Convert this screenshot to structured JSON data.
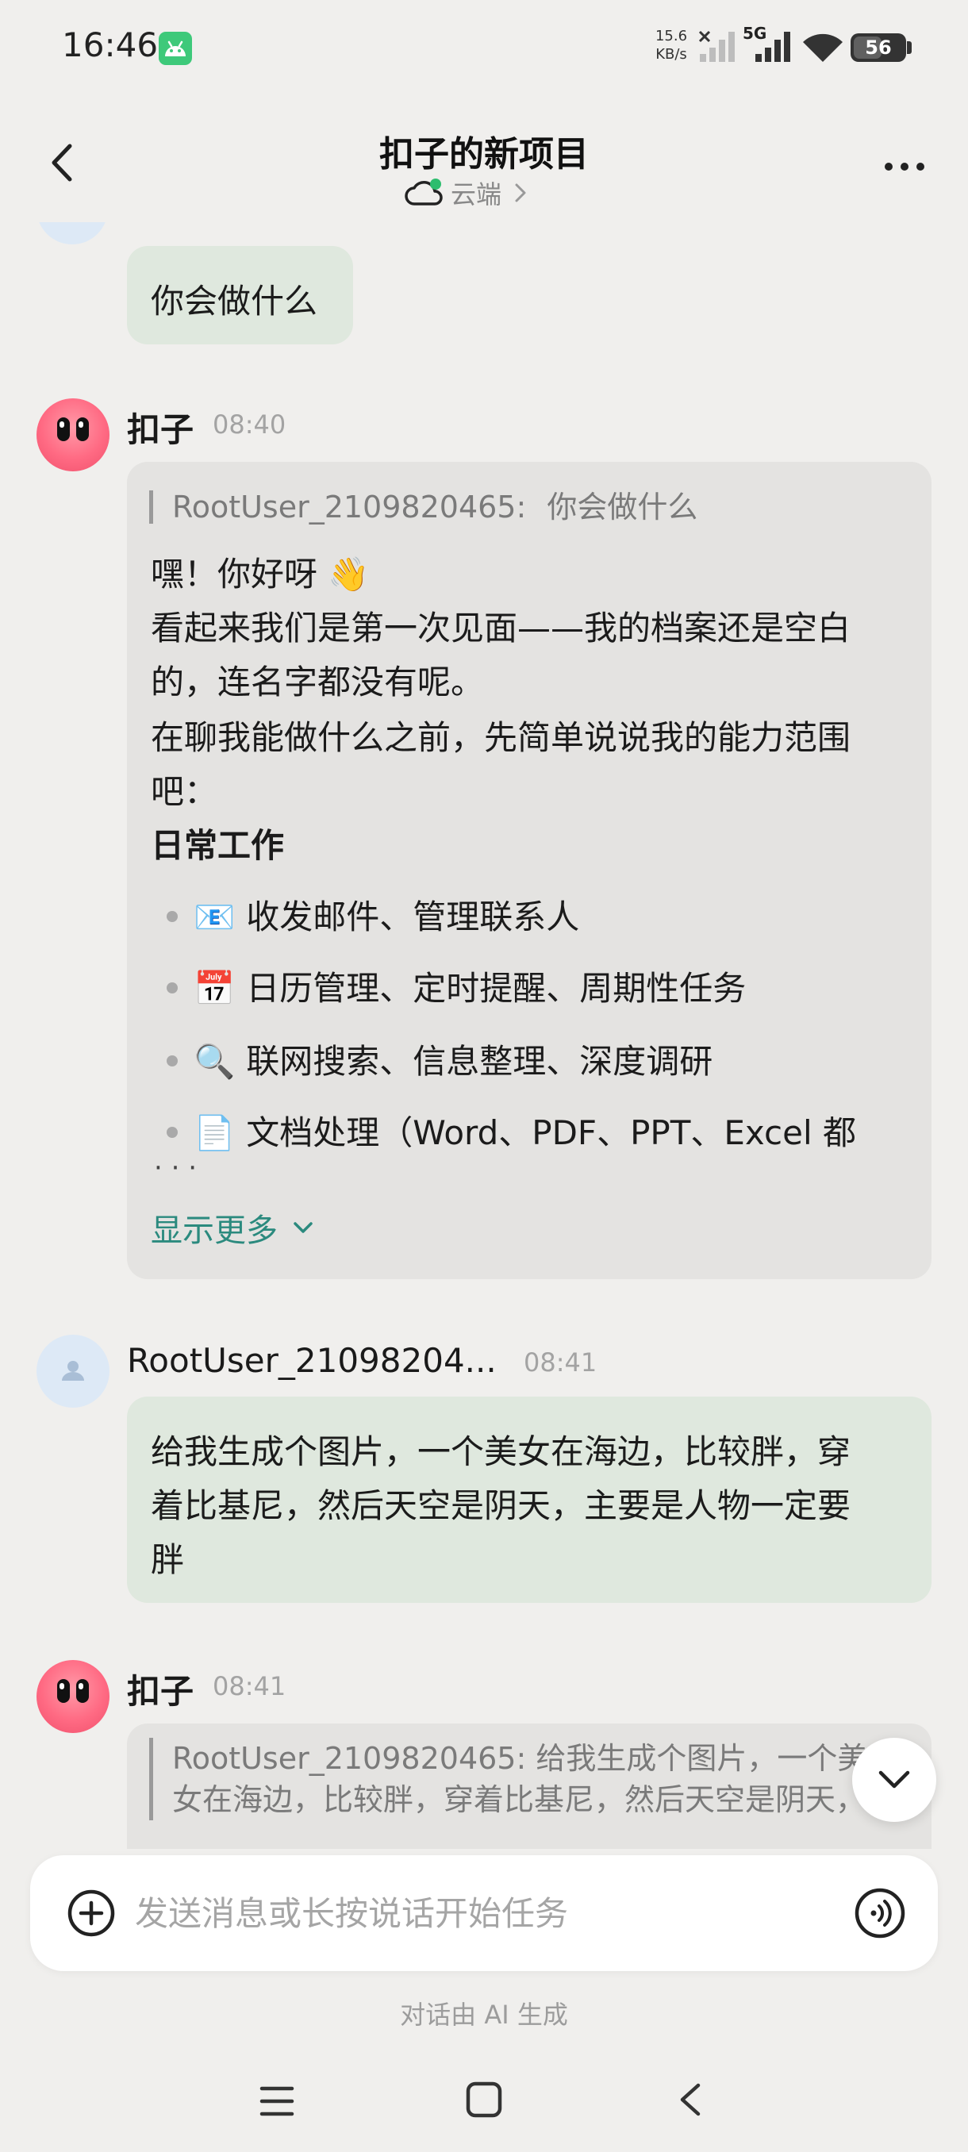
{
  "status_bar": {
    "time": "16:46",
    "net_speed_value": "15.6",
    "net_speed_unit": "KB/s",
    "network": "5G",
    "battery": "56",
    "battery_level": 0.56
  },
  "header": {
    "title": "扣子的新项目",
    "subtitle": "云端"
  },
  "messages": {
    "user_1": {
      "text": "你会做什么"
    },
    "bot_1": {
      "name": "扣子",
      "time": "08:40",
      "quote_user": "RootUser_2109820465:",
      "quote_text": "你会做什么",
      "lines": [
        "嘿！你好呀 👋",
        "看起来我们是第一次见面——我的档案还是空白",
        "的，连名字都没有呢。",
        "在聊我能做什么之前，先简单说说我的能力范围",
        "吧："
      ],
      "section_title": "日常工作",
      "bullets": [
        {
          "emoji": "📧",
          "text": "收发邮件、管理联系人"
        },
        {
          "emoji": "📅",
          "text": "日历管理、定时提醒、周期性任务"
        },
        {
          "emoji": "🔍",
          "text": "联网搜索、信息整理、深度调研"
        },
        {
          "emoji": "📄",
          "text": "文档处理（Word、PDF、PPT、Excel 都"
        }
      ],
      "ellipsis": "· · ·",
      "show_more": "显示更多"
    },
    "user_2": {
      "name": "RootUser_21098204...",
      "time": "08:41",
      "lines": [
        "给我生成个图片，一个美女在海边，比较胖，穿",
        "着比基尼，然后天空是阴天，主要是人物一定要",
        "胖"
      ]
    },
    "bot_2": {
      "name": "扣子",
      "time": "08:41",
      "quote_line1": "RootUser_2109820465:  给我生成个图片，一个美",
      "quote_line2": "女在海边，比较胖，穿着比基尼，然后天空是阴天，..."
    }
  },
  "input": {
    "placeholder": "发送消息或长按说话开始任务"
  },
  "footer": {
    "disclaimer": "对话由 AI 生成"
  },
  "colors": {
    "background": "#f0efed",
    "user_bubble": "#dfe8de",
    "bot_bubble": "#e4e3e1",
    "accent": "#2b8a7e",
    "online": "#2dbd6e"
  },
  "icons": {
    "back": "chevron-left-icon",
    "more": "more-dots-icon",
    "cloud": "cloud-icon",
    "plus": "plus-circle-icon",
    "voice": "voice-wave-icon",
    "scroll": "chevron-down-icon"
  }
}
